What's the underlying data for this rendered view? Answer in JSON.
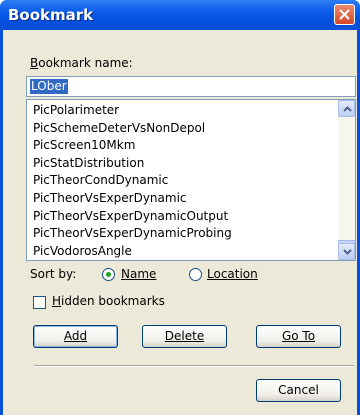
{
  "window": {
    "title": "Bookmark"
  },
  "bookmark_name": {
    "label": "Bookmark name:",
    "value": "LOber"
  },
  "bookmarks": {
    "items": [
      "PicPolarimeter",
      "PicSchemeDeterVsNonDepol",
      "PicScreen10Mkm",
      "PicStatDistribution",
      "PicTheorCondDynamic",
      "PicTheorVsExperDynamic",
      "PicTheorVsExperDynamicOutput",
      "PicTheorVsExperDynamicProbing",
      "PicVodorosAngle"
    ]
  },
  "sort": {
    "label": "Sort by:",
    "options": [
      {
        "label": "Name",
        "selected": true
      },
      {
        "label": "Location",
        "selected": false
      }
    ]
  },
  "hidden_bookmarks": {
    "label": "Hidden bookmarks",
    "checked": false
  },
  "buttons": {
    "add": "Add",
    "delete": "Delete",
    "goto": "Go To",
    "cancel": "Cancel"
  }
}
